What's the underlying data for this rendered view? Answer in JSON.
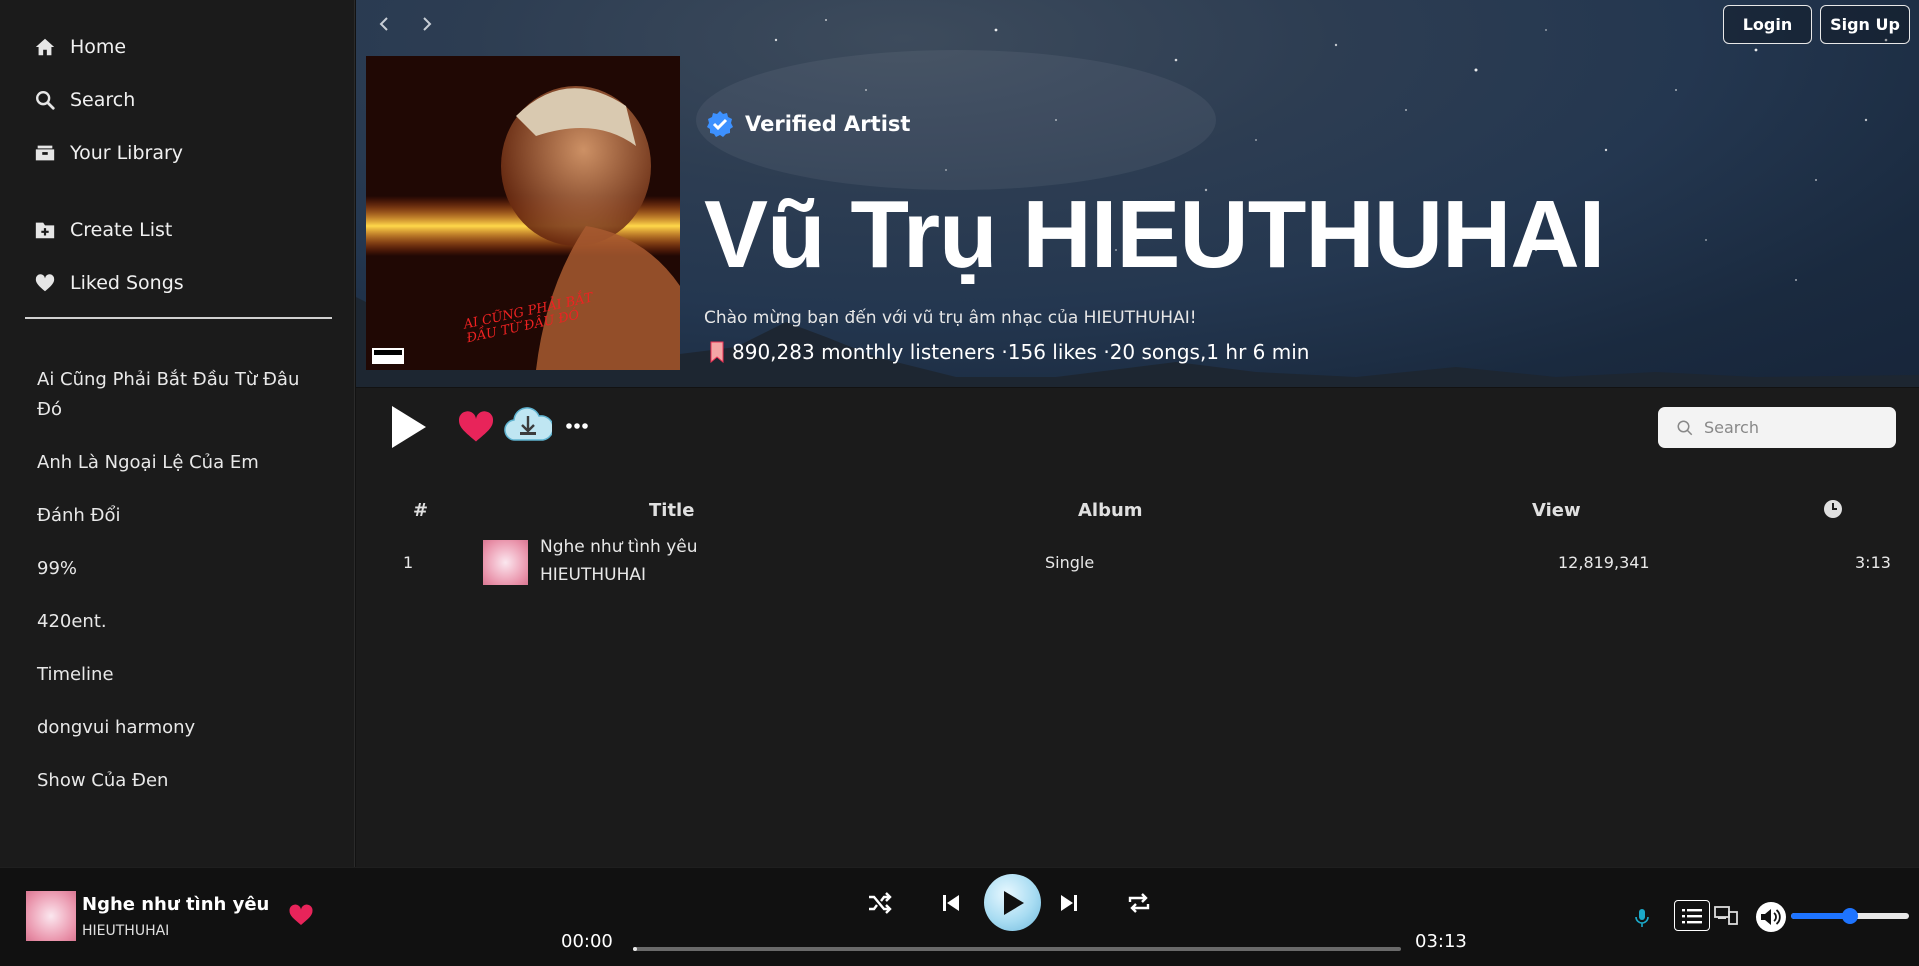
{
  "sidebar": {
    "nav": [
      {
        "label": "Home",
        "icon": "home-icon"
      },
      {
        "label": "Search",
        "icon": "search-icon"
      },
      {
        "label": "Your Library",
        "icon": "library-icon"
      },
      {
        "label": "Create List",
        "icon": "add-folder-icon"
      },
      {
        "label": "Liked Songs",
        "icon": "heart-icon"
      }
    ],
    "playlists": [
      "Ai Cũng Phải Bắt Đầu Từ Đâu Đó",
      "Anh Là Ngoại Lệ Của Em",
      "Đánh Đổi",
      "99%",
      "420ent.",
      "Timeline",
      "dongvui harmony",
      "Show Của Đen"
    ]
  },
  "header": {
    "login_label": "Login",
    "signup_label": "Sign Up"
  },
  "artist": {
    "verified_label": "Verified Artist",
    "name": "Vũ Trụ HIEUTHUHAI",
    "description": "Chào mừng bạn đến với vũ trụ âm nhạc của HIEUTHUHAI!",
    "stats": "890,283 monthly listeners ·156 likes ·20 songs,1 hr 6 min",
    "cover_text": "AI CŨNG PHẢI BẮT ĐẦU TỪ ĐÂU ĐÓ",
    "cover_badge": "PARENTAL ADVISORY EXPLICIT CONTENT"
  },
  "controls": {
    "search_placeholder": "Search",
    "accent_color": "#e8245a"
  },
  "table": {
    "headers": {
      "index": "#",
      "title": "Title",
      "album": "Album",
      "view": "View"
    },
    "rows": [
      {
        "index": "1",
        "title": "Nghe như tình yêu",
        "artist": "HIEUTHUHAI",
        "album": "Single",
        "views": "12,819,341",
        "duration": "3:13"
      }
    ]
  },
  "player": {
    "track_title": "Nghe như tình yêu",
    "track_artist": "HIEUTHUHAI",
    "current_time": "00:00",
    "total_time": "03:13",
    "progress": 0,
    "volume_percent": 50,
    "volume_color": "#1e74ff"
  }
}
